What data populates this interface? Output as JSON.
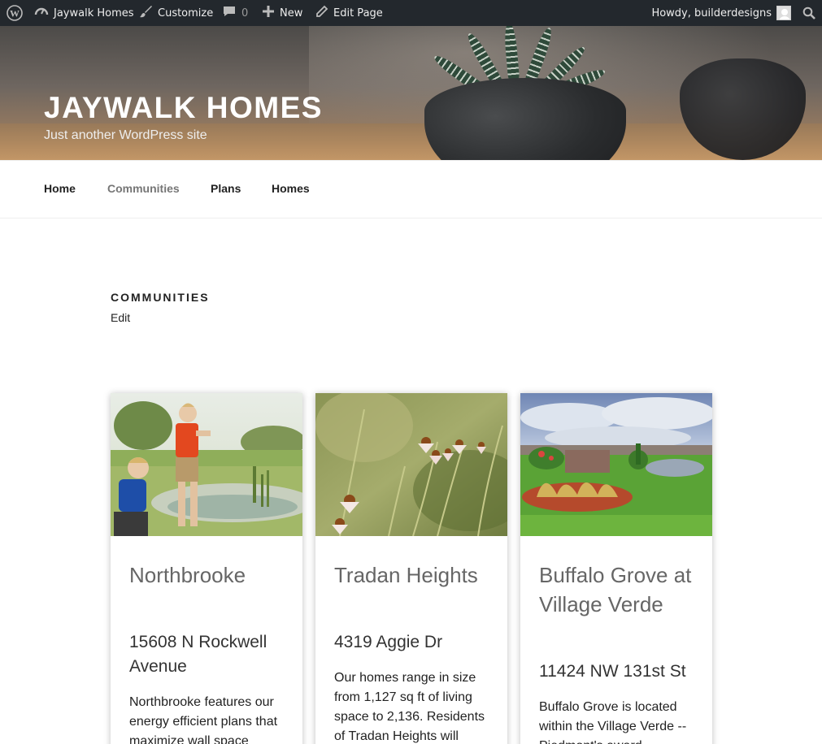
{
  "admin_bar": {
    "site_name": "Jaywalk Homes",
    "customize": "Customize",
    "comments_count": "0",
    "new": "New",
    "edit_page": "Edit Page",
    "howdy": "Howdy, builderdesigns"
  },
  "header": {
    "site_title": "Jaywalk Homes",
    "tagline": "Just another WordPress site"
  },
  "nav": {
    "items": [
      {
        "label": "Home",
        "current": false
      },
      {
        "label": "Communities",
        "current": true
      },
      {
        "label": "Plans",
        "current": false
      },
      {
        "label": "Homes",
        "current": false
      }
    ]
  },
  "page": {
    "title": "Communities",
    "edit_label": "Edit"
  },
  "communities": [
    {
      "name": "Northbrooke",
      "address": "15608 N Rockwell Avenue",
      "description": "Northbrooke features our energy efficient plans that maximize wall space"
    },
    {
      "name": "Tradan Heights",
      "address": "4319 Aggie Dr",
      "description": "Our homes range in size from 1,127 sq ft of living space to 2,136. Residents of Tradan Heights will"
    },
    {
      "name": "Buffalo Grove at Village Verde",
      "address": "11424 NW 131st St",
      "description": "Buffalo Grove is located within the Village Verde -- Piedmont's award"
    }
  ],
  "colors": {
    "admin_bar_bg": "#23282d",
    "nav_current": "#767676",
    "card_title": "#666666"
  }
}
